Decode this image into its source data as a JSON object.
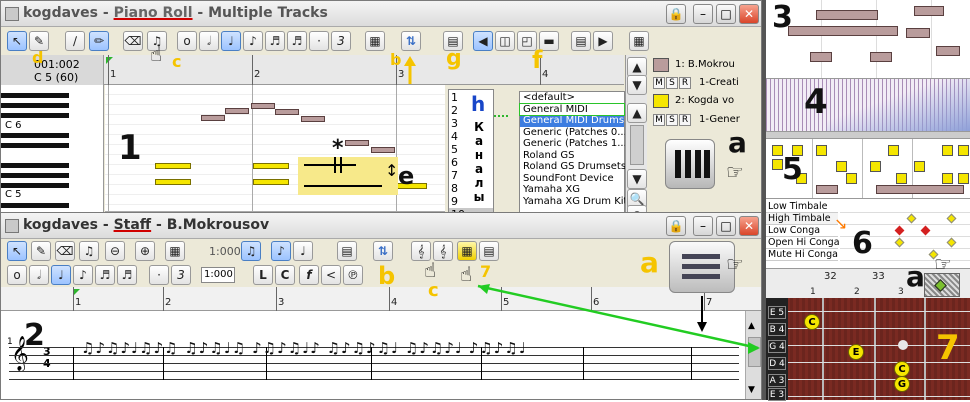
{
  "piano_roll": {
    "app": "kogdaves",
    "sep1": " - ",
    "view": "Piano Roll",
    "sep2": " - ",
    "subtitle": "Multiple Tracks",
    "position": "001:002",
    "pitch": "C 5 (60)",
    "ruler": [
      "1",
      "2",
      "3",
      "4"
    ],
    "key_labels": [
      "C 6",
      "C 5"
    ],
    "channels": [
      "1",
      "2",
      "3",
      "4",
      "5",
      "6",
      "7",
      "8",
      "9",
      "10"
    ],
    "channel_word": [
      "К",
      "а",
      "н",
      "а",
      "л",
      "ы"
    ],
    "instruments": [
      "<default>",
      "General MIDI",
      "General MIDI Drums",
      "Generic (Patches 0...",
      "Generic (Patches 1...",
      "Roland GS",
      "Roland GS Drumsets",
      "SoundFont Device",
      "Yamaha XG",
      "Yamaha XG Drum Kit"
    ],
    "tracks": [
      {
        "name": "1: B.Mokrou",
        "m": "M",
        "s": "S",
        "r": "R",
        "instrument": "1-Creati",
        "color": "#b99c9c"
      },
      {
        "name": "2: Kogda vo",
        "m": "M",
        "s": "S",
        "r": "R",
        "instrument": "1-Gener",
        "color": "#f5e600"
      }
    ]
  },
  "staff": {
    "app": "kogdaves",
    "sep1": " - ",
    "view": "Staff",
    "sep2": " - ",
    "subtitle": "B.Mokrousov",
    "zoom": "1:000",
    "snap": "1:000",
    "ruler": [
      "1",
      "2",
      "3",
      "4",
      "5",
      "6",
      "7"
    ],
    "measure_start": "1",
    "time_sig_top": "3",
    "time_sig_bottom": "4"
  },
  "drum_map": {
    "names": [
      "Low Timbale",
      "High Timbale",
      "Low Conga",
      "Open Hi Conga",
      "Mute Hi Conga"
    ],
    "ruler": [
      "32",
      "33"
    ],
    "beats": [
      "1",
      "2",
      "3"
    ]
  },
  "fretboard": {
    "strings": [
      "E 5",
      "B 4",
      "G 4",
      "D 4",
      "A 3",
      "E 3"
    ],
    "notes": [
      "C",
      "E",
      "C",
      "G"
    ]
  },
  "annotations": {
    "n1": "1",
    "n2": "2",
    "n3": "3",
    "n4": "4",
    "n5": "5",
    "n6": "6",
    "n7": "7",
    "a": "a",
    "b": "b",
    "c": "c",
    "d": "d",
    "e": "e",
    "f": "f",
    "g": "g",
    "h": "h",
    "star": "*"
  }
}
